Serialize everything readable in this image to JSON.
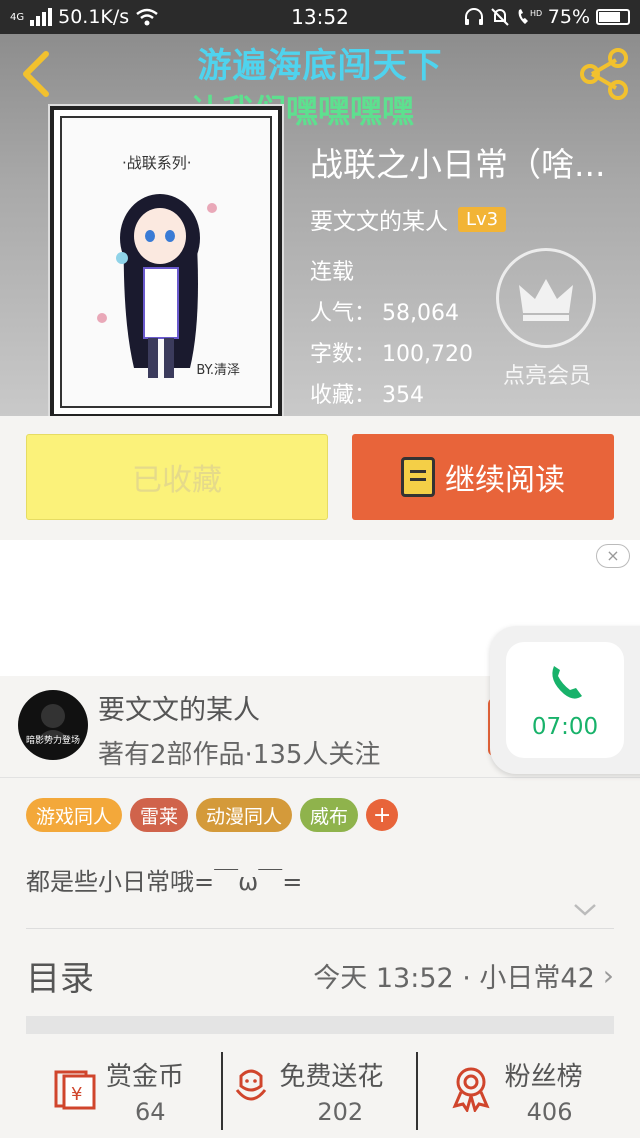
{
  "status_bar": {
    "network": "4G",
    "speed": "50.1K/s",
    "time": "13:52",
    "battery": "75%",
    "battery_level": 0.75
  },
  "header": {
    "banner_line1": "游遍海底闯天下",
    "banner_line2": "让我们嘿嘿嘿嘿",
    "book_title": "战联之小日常（啥...",
    "author": "要文文的某人",
    "level": "Lv3",
    "status": "连载",
    "popularity_label": "人气：",
    "popularity": "58,064",
    "words_label": "字数：",
    "words": "100,720",
    "favorites_label": "收藏：",
    "favorites": "354",
    "vip_label": "点亮会员",
    "cover_title": "·战联系列·",
    "cover_author": "BY.清泽"
  },
  "actions": {
    "collected": "已收藏",
    "continue_reading": "继续阅读"
  },
  "ad": {
    "close": "×"
  },
  "author_section": {
    "name": "要文文的某人",
    "info": "著有2部作品·135人关注",
    "avatar_text": "暗影势力登场"
  },
  "call": {
    "time": "07:00"
  },
  "tags": [
    {
      "label": "游戏同人",
      "color": "#f3a83a"
    },
    {
      "label": "雷莱",
      "color": "#d0634b"
    },
    {
      "label": "动漫同人",
      "color": "#d49a3a"
    },
    {
      "label": "威布",
      "color": "#8fb34c"
    }
  ],
  "tag_add": "+",
  "description": "都是些小日常哦=￣ω￣=",
  "toc": {
    "label": "目录",
    "latest": "今天 13:52 · 小日常42",
    "arrow": "›"
  },
  "bottom": {
    "reward_label": "赏金币",
    "reward_value": "64",
    "flower_label": "免费送花",
    "flower_value": "202",
    "fans_label": "粉丝榜",
    "fans_value": "406"
  },
  "colors": {
    "accent": "#e8643a",
    "collected_bg": "#fbf27a",
    "call_green": "#18b26a",
    "back_yellow": "#f2c12e"
  }
}
